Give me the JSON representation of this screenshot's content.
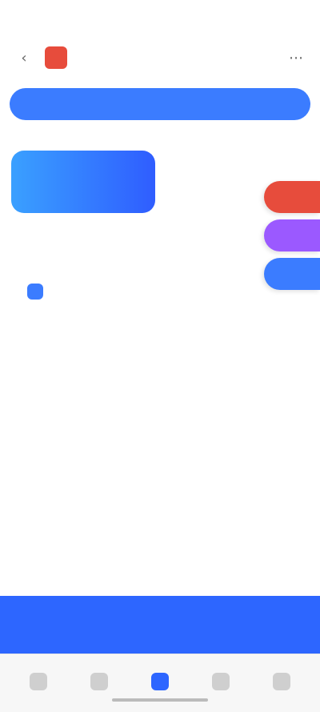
{
  "status": {
    "time": "",
    "signal": "",
    "wifi": "",
    "battery": ""
  },
  "header": {
    "title": ""
  },
  "top_pill": {
    "label": ""
  },
  "section": {
    "label": ""
  },
  "feature_card": {
    "label": ""
  },
  "right_tabs": [
    {
      "label": ""
    },
    {
      "label": ""
    },
    {
      "label": ""
    }
  ],
  "content": {
    "title": "",
    "subtitle": "",
    "highlight": "",
    "rows": [
      {
        "label": "",
        "value": ""
      },
      {
        "label": "",
        "value": ""
      },
      {
        "label": "",
        "value": ""
      },
      {
        "label": "",
        "value": ""
      },
      {
        "label": "",
        "value": ""
      },
      {
        "label": "",
        "value": ""
      }
    ]
  },
  "bottom_bar": {
    "label": ""
  },
  "tabbar": [
    {
      "label": ""
    },
    {
      "label": ""
    },
    {
      "label": ""
    },
    {
      "label": ""
    },
    {
      "label": ""
    }
  ],
  "colors": {
    "primary": "#2d66ff",
    "blue_gradient_start": "#3aa0ff",
    "blue_gradient_end": "#2f5dff",
    "green_text": "#1fbf66",
    "red_tab": "#e74c3c",
    "purple_tab": "#9b59ff",
    "blue_tab": "#3b7cff"
  }
}
